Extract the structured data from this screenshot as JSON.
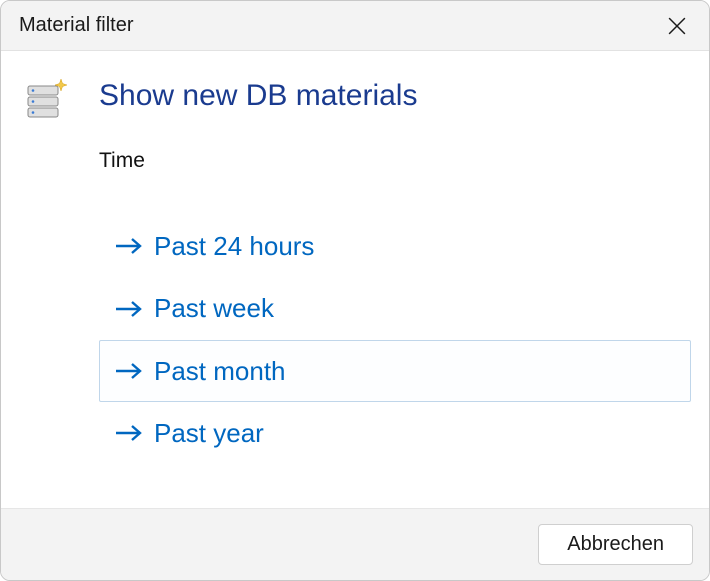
{
  "titlebar": {
    "title": "Material filter"
  },
  "content": {
    "heading": "Show new DB materials",
    "section_label": "Time",
    "options": [
      {
        "label": "Past 24 hours",
        "selected": false
      },
      {
        "label": "Past week",
        "selected": false
      },
      {
        "label": "Past month",
        "selected": true
      },
      {
        "label": "Past year",
        "selected": false
      }
    ]
  },
  "footer": {
    "cancel_label": "Abbrechen"
  },
  "colors": {
    "link": "#0067c0",
    "heading": "#1a3b8f"
  }
}
